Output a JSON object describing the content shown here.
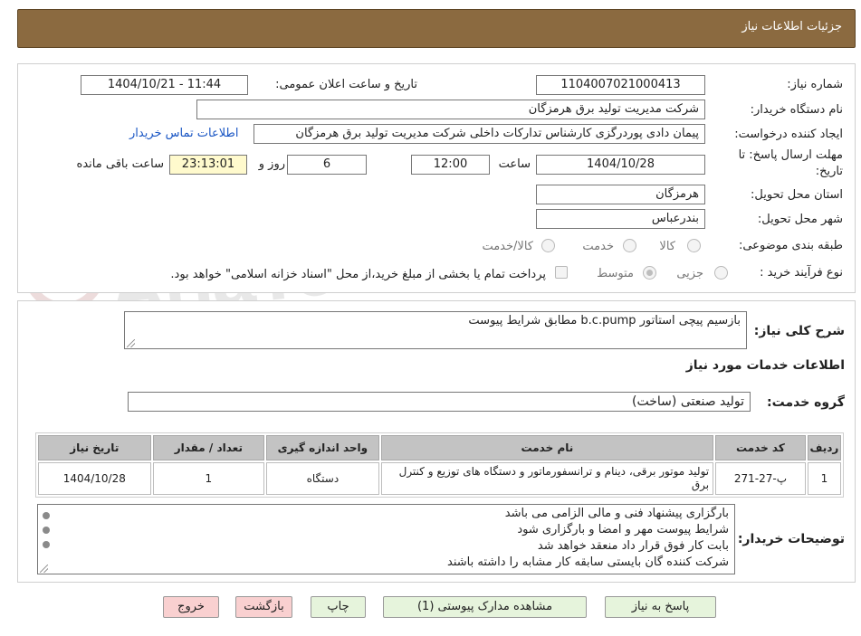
{
  "header": {
    "title": "جزئیات اطلاعات نیاز"
  },
  "form": {
    "need_number_label": "شماره نیاز:",
    "need_number": "1104007021000413",
    "announce_label": "تاریخ و ساعت اعلان عمومی:",
    "announce_value": "1404/10/21 - 11:44",
    "buyer_org_label": "نام دستگاه خریدار:",
    "buyer_org": "شرکت مدیریت تولید برق هرمزگان",
    "creator_label": "ایجاد کننده درخواست:",
    "creator": "پیمان دادی پوردرگزی کارشناس تدارکات داخلی شرکت مدیریت تولید برق هرمزگان",
    "contact_link": "اطلاعات تماس خریدار",
    "deadline_label_1": "مهلت ارسال پاسخ: تا",
    "deadline_label_2": "تاریخ:",
    "deadline_date": "1404/10/28",
    "time_label": "ساعت",
    "deadline_time": "12:00",
    "days_value": "6",
    "days_label": "روز و",
    "remaining_time": "23:13:01",
    "remaining_label": "ساعت باقی مانده",
    "province_label": "استان محل تحویل:",
    "province": "هرمزگان",
    "city_label": "شهر محل تحویل:",
    "city": "بندرعباس",
    "category_label": "طبقه بندی موضوعی:",
    "category_options": [
      "کالا",
      "خدمت",
      "کالا/خدمت"
    ],
    "process_label": "نوع فرآیند خرید :",
    "process_options": [
      "جزیی",
      "متوسط"
    ],
    "payment_note": "پرداخت تمام یا بخشی از مبلغ خرید،از محل \"اسناد خزانه اسلامی\" خواهد بود."
  },
  "description": {
    "label": "شرح کلی نیاز:",
    "text": "بازسیم پیچی استاتور b.c.pump مطابق شرایط پیوست"
  },
  "services_section": {
    "title": "اطلاعات خدمات مورد نیاز",
    "group_label": "گروه خدمت:",
    "group_value": "تولید صنعتی (ساخت)"
  },
  "services_table": {
    "headers": [
      "ردیف",
      "کد خدمت",
      "نام خدمت",
      "واحد اندازه گیری",
      "تعداد / مقدار",
      "تاریخ نیاز"
    ],
    "rows": [
      {
        "row": "1",
        "code": "پ-27-271",
        "name": "تولید موتور برقی، دینام و ترانسفورماتور و دستگاه های توزیع و کنترل برق",
        "unit": "دستگاه",
        "qty": "1",
        "date": "1404/10/28"
      }
    ]
  },
  "buyer_notes": {
    "label": "توضیحات خریدار:",
    "lines": [
      "بارگزاری پیشنهاد فنی و مالی الزامی می باشد",
      "شرایط پیوست مهر و امضا و بارگزاری شود",
      "بابت کار فوق قرار داد منعقد خواهد شد",
      "شرکت کننده گان بایستی سابقه کار مشابه را داشته باشند"
    ]
  },
  "buttons": {
    "respond": "پاسخ به نیاز",
    "attachments": "مشاهده مدارک پیوستی (1)",
    "print": "چاپ",
    "back": "بازگشت",
    "exit": "خروج"
  },
  "watermark": {
    "text": "AriaTender.neT"
  },
  "colors": {
    "header_bg": "#8b6a40",
    "link": "#1a56c4",
    "green_button": "#e6f4dc",
    "red_button": "#f9d0d0",
    "remaining_bg": "#fffacd"
  }
}
